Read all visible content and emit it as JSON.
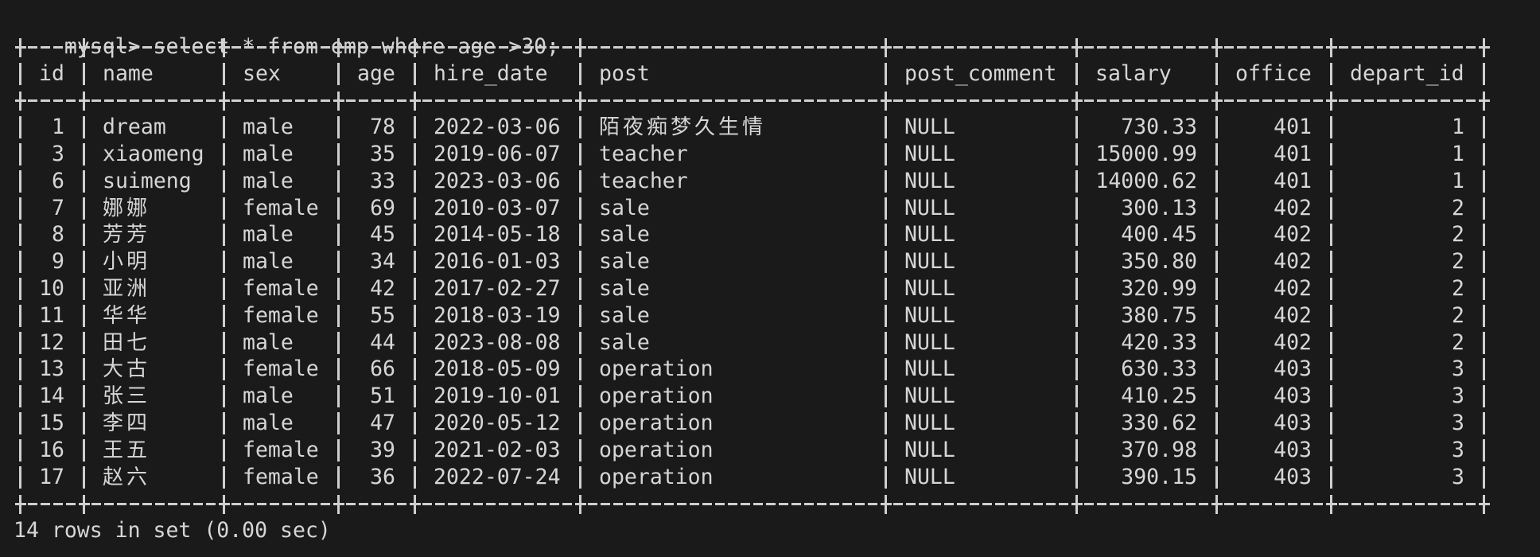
{
  "terminal": {
    "prompt": "mysql> ",
    "command": "select * from emp where age >30;",
    "footer": "14 rows in set (0.00 sec)"
  },
  "table": {
    "columns": [
      {
        "key": "id",
        "label": "id",
        "align": "right"
      },
      {
        "key": "name",
        "label": "name",
        "align": "left"
      },
      {
        "key": "sex",
        "label": "sex",
        "align": "left"
      },
      {
        "key": "age",
        "label": "age",
        "align": "right"
      },
      {
        "key": "hire_date",
        "label": "hire_date",
        "align": "left"
      },
      {
        "key": "post",
        "label": "post",
        "align": "left"
      },
      {
        "key": "post_comment",
        "label": "post_comment",
        "align": "left"
      },
      {
        "key": "salary",
        "label": "salary",
        "align": "right"
      },
      {
        "key": "office",
        "label": "office",
        "align": "right"
      },
      {
        "key": "depart_id",
        "label": "depart_id",
        "align": "right"
      }
    ],
    "rows": [
      [
        "1",
        "dream",
        "male",
        "78",
        "2022-03-06",
        "陌夜痴梦久生情",
        "NULL",
        "730.33",
        "401",
        "1"
      ],
      [
        "3",
        "xiaomeng",
        "male",
        "35",
        "2019-06-07",
        "teacher",
        "NULL",
        "15000.99",
        "401",
        "1"
      ],
      [
        "6",
        "suimeng",
        "male",
        "33",
        "2023-03-06",
        "teacher",
        "NULL",
        "14000.62",
        "401",
        "1"
      ],
      [
        "7",
        "娜娜",
        "female",
        "69",
        "2010-03-07",
        "sale",
        "NULL",
        "300.13",
        "402",
        "2"
      ],
      [
        "8",
        "芳芳",
        "male",
        "45",
        "2014-05-18",
        "sale",
        "NULL",
        "400.45",
        "402",
        "2"
      ],
      [
        "9",
        "小明",
        "male",
        "34",
        "2016-01-03",
        "sale",
        "NULL",
        "350.80",
        "402",
        "2"
      ],
      [
        "10",
        "亚洲",
        "female",
        "42",
        "2017-02-27",
        "sale",
        "NULL",
        "320.99",
        "402",
        "2"
      ],
      [
        "11",
        "华华",
        "female",
        "55",
        "2018-03-19",
        "sale",
        "NULL",
        "380.75",
        "402",
        "2"
      ],
      [
        "12",
        "田七",
        "male",
        "44",
        "2023-08-08",
        "sale",
        "NULL",
        "420.33",
        "402",
        "2"
      ],
      [
        "13",
        "大古",
        "female",
        "66",
        "2018-05-09",
        "operation",
        "NULL",
        "630.33",
        "403",
        "3"
      ],
      [
        "14",
        "张三",
        "male",
        "51",
        "2019-10-01",
        "operation",
        "NULL",
        "410.25",
        "403",
        "3"
      ],
      [
        "15",
        "李四",
        "male",
        "47",
        "2020-05-12",
        "operation",
        "NULL",
        "330.62",
        "403",
        "3"
      ],
      [
        "16",
        "王五",
        "female",
        "39",
        "2021-02-03",
        "operation",
        "NULL",
        "370.98",
        "403",
        "3"
      ],
      [
        "17",
        "赵六",
        "female",
        "36",
        "2022-07-24",
        "operation",
        "NULL",
        "390.15",
        "403",
        "3"
      ]
    ]
  },
  "colors": {
    "background": "#1a1a1a",
    "text": "#d6d6d6"
  }
}
